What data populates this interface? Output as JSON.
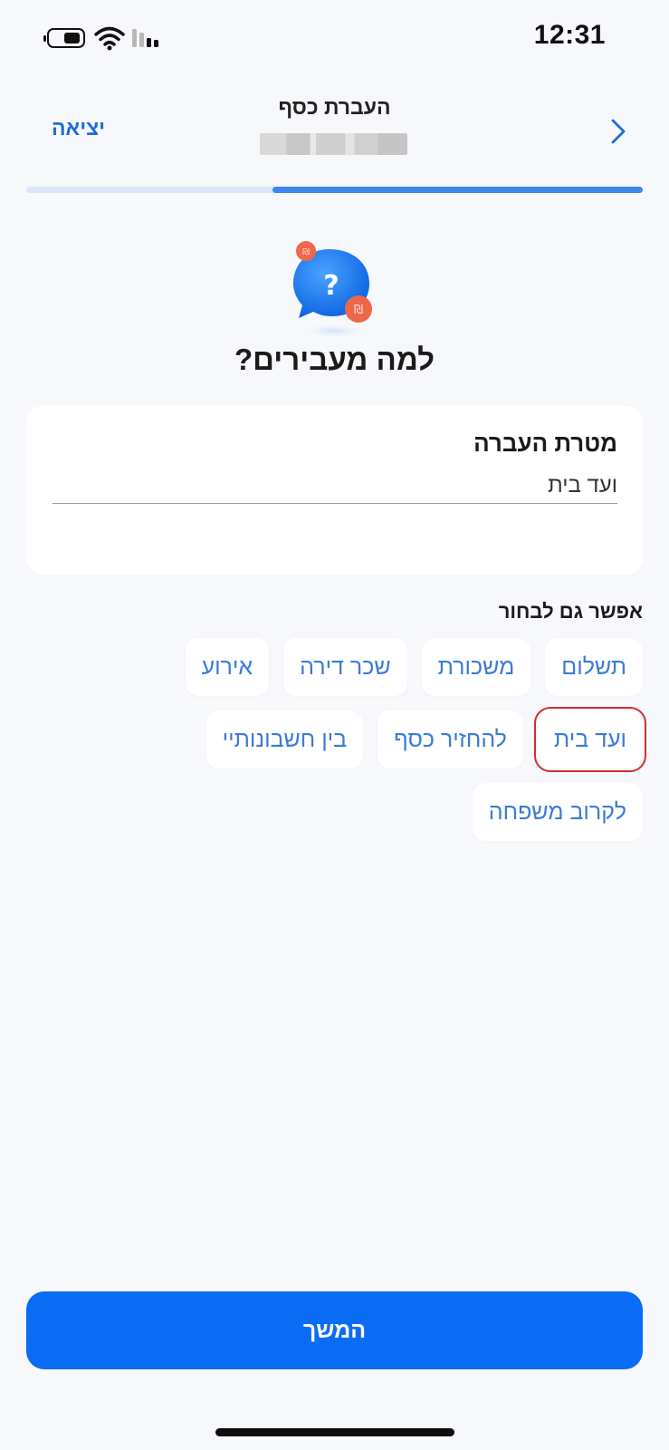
{
  "status_bar": {
    "time": "12:31",
    "icons": [
      "battery-icon",
      "wifi-icon",
      "signal-icon"
    ]
  },
  "header": {
    "title": "העברת כסף",
    "exit_label": "יציאה",
    "back_icon": "chevron-right-icon"
  },
  "progress": {
    "fraction_complete": 0.6
  },
  "illustration": {
    "icon": "question-chat-bubble-icon"
  },
  "page": {
    "title": "למה מעבירים?"
  },
  "purpose_field": {
    "label": "מטרת העברה",
    "value": "ועד בית"
  },
  "suggestions": {
    "title": "אפשר גם לבחור",
    "rows": [
      [
        "תשלום",
        "משכורת",
        "שכר דירה",
        "אירוע"
      ],
      [
        "ועד בית",
        "להחזיר כסף",
        "בין חשבונותיי"
      ],
      [
        "לקרוב משפחה"
      ]
    ],
    "highlighted": "ועד בית"
  },
  "footer": {
    "continue_label": "המשך"
  },
  "colors": {
    "accent": "#0a6cf5",
    "link": "#1b6ed6",
    "chip_text": "#3a7bd5",
    "background": "#f6f8fb",
    "highlight": "#d32f2f"
  }
}
